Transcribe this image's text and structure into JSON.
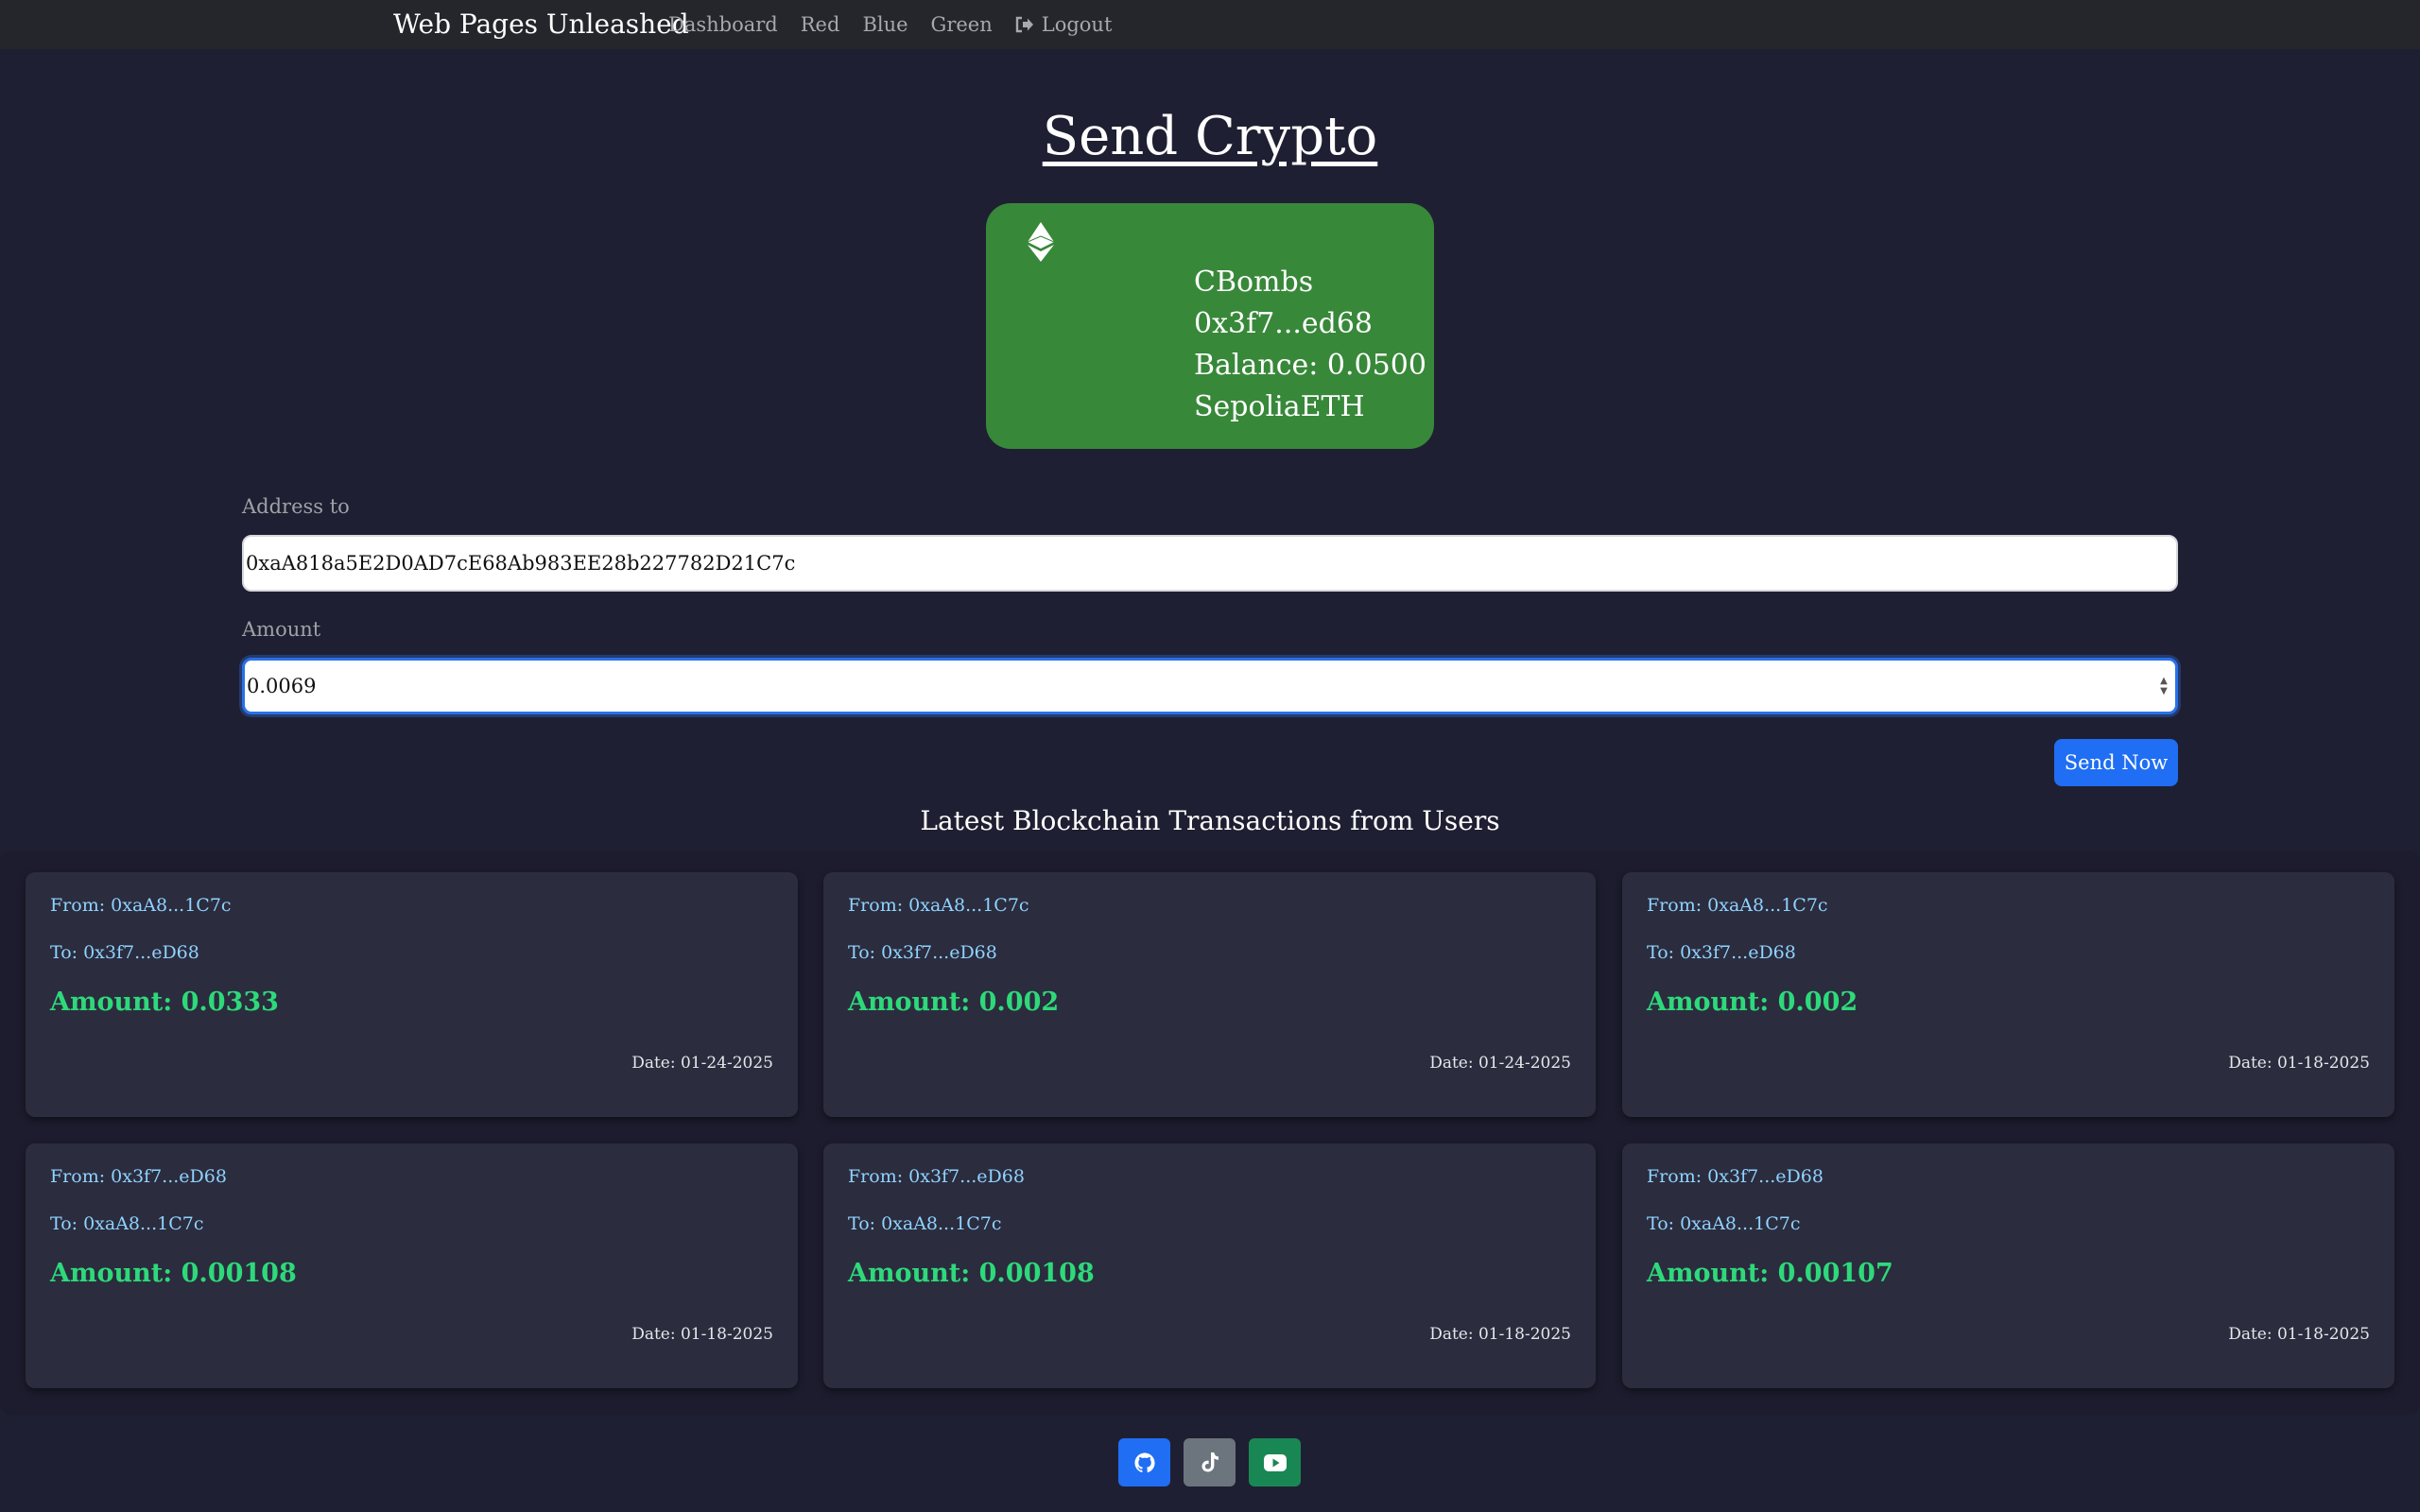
{
  "nav": {
    "brand": "Web Pages Unleashed",
    "links": [
      "Dashboard",
      "Red",
      "Blue",
      "Green"
    ],
    "logout": "Logout"
  },
  "page": {
    "title": "Send Crypto"
  },
  "wallet": {
    "name": "CBombs",
    "address": "0x3f7...ed68",
    "balance": "Balance: 0.0500",
    "network": "SepoliaETH",
    "icon": "ethereum-icon",
    "card_color": "#38883a"
  },
  "form": {
    "address_label": "Address to",
    "address_value": "0xaA818a5E2D0AD7cE68Ab983EE28b227782D21C7c",
    "amount_label": "Amount",
    "amount_value": "0.0069",
    "send_label": "Send Now"
  },
  "transactions": {
    "title": "Latest Blockchain Transactions from Users",
    "items": [
      {
        "from": "From: 0xaA8...1C7c",
        "to": "To: 0x3f7...eD68",
        "amount": "Amount: 0.0333",
        "date": "Date: 01-24-2025"
      },
      {
        "from": "From: 0xaA8...1C7c",
        "to": "To: 0x3f7...eD68",
        "amount": "Amount: 0.002",
        "date": "Date: 01-24-2025"
      },
      {
        "from": "From: 0xaA8...1C7c",
        "to": "To: 0x3f7...eD68",
        "amount": "Amount: 0.002",
        "date": "Date: 01-18-2025"
      },
      {
        "from": "From: 0x3f7...eD68",
        "to": "To: 0xaA8...1C7c",
        "amount": "Amount: 0.00108",
        "date": "Date: 01-18-2025"
      },
      {
        "from": "From: 0x3f7...eD68",
        "to": "To: 0xaA8...1C7c",
        "amount": "Amount: 0.00108",
        "date": "Date: 01-18-2025"
      },
      {
        "from": "From: 0x3f7...eD68",
        "to": "To: 0xaA8...1C7c",
        "amount": "Amount: 0.00107",
        "date": "Date: 01-18-2025"
      }
    ]
  },
  "footer": {
    "icons": [
      {
        "name": "github-icon",
        "color": "#1f6ef3"
      },
      {
        "name": "tiktok-icon",
        "color": "#6c757d"
      },
      {
        "name": "youtube-icon",
        "color": "#198754"
      }
    ]
  }
}
